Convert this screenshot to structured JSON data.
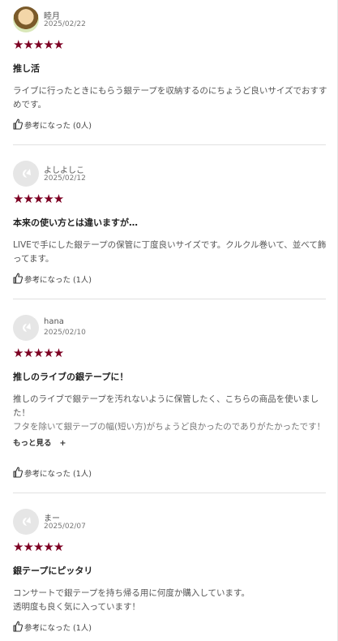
{
  "colors": {
    "star": "#7d0023",
    "divider": "#e1e1e1",
    "avatar_bg": "#e6e6e6"
  },
  "icons": {
    "rating": "star-icon",
    "helpful": "thumbs-up-icon",
    "placeholder_avatar": "default-user-icon"
  },
  "reviews": [
    {
      "reviewer": "睦月",
      "date": "2025/02/22",
      "stars": "★★★★★",
      "rating": 5,
      "title": "推し活",
      "body": [
        "ライブに行ったときにもらう銀テープを収納するのにちょうど良いサイズでおすす",
        "めです。"
      ],
      "helpful_label": "参考になった",
      "helpful_count": "(0人)"
    },
    {
      "reviewer": "よしよしこ",
      "date": "2025/02/12",
      "stars": "★★★★★",
      "rating": 5,
      "title": "本来の使い方とは違いますが…",
      "body": [
        "LIVEで手にした銀テープの保管に丁度良いサイズです。クルクル巻いて、並べて飾",
        "ってます。"
      ],
      "helpful_label": "参考になった",
      "helpful_count": "(1人)"
    },
    {
      "reviewer": "hana",
      "date": "2025/02/10",
      "stars": "★★★★★",
      "rating": 5,
      "title": "推しのライブの銀テープに！",
      "body": [
        "推しのライブで銀テープを汚れないように保管したく、こちらの商品を使いまし",
        "た！",
        "フタを除いて銀テープの幅(短い方)がちょうど良かったのでありがたかったです！"
      ],
      "more_label": "もっと見る",
      "more_icon": "+",
      "helpful_label": "参考になった",
      "helpful_count": "(1人)"
    },
    {
      "reviewer": "まー",
      "date": "2025/02/07",
      "stars": "★★★★★",
      "rating": 5,
      "title": "銀テープにピッタリ",
      "body": [
        "コンサートで銀テープを持ち帰る用に何度か購入しています。",
        "透明度も良く気に入っています！"
      ],
      "helpful_label": "参考になった",
      "helpful_count": "(1人)"
    }
  ]
}
